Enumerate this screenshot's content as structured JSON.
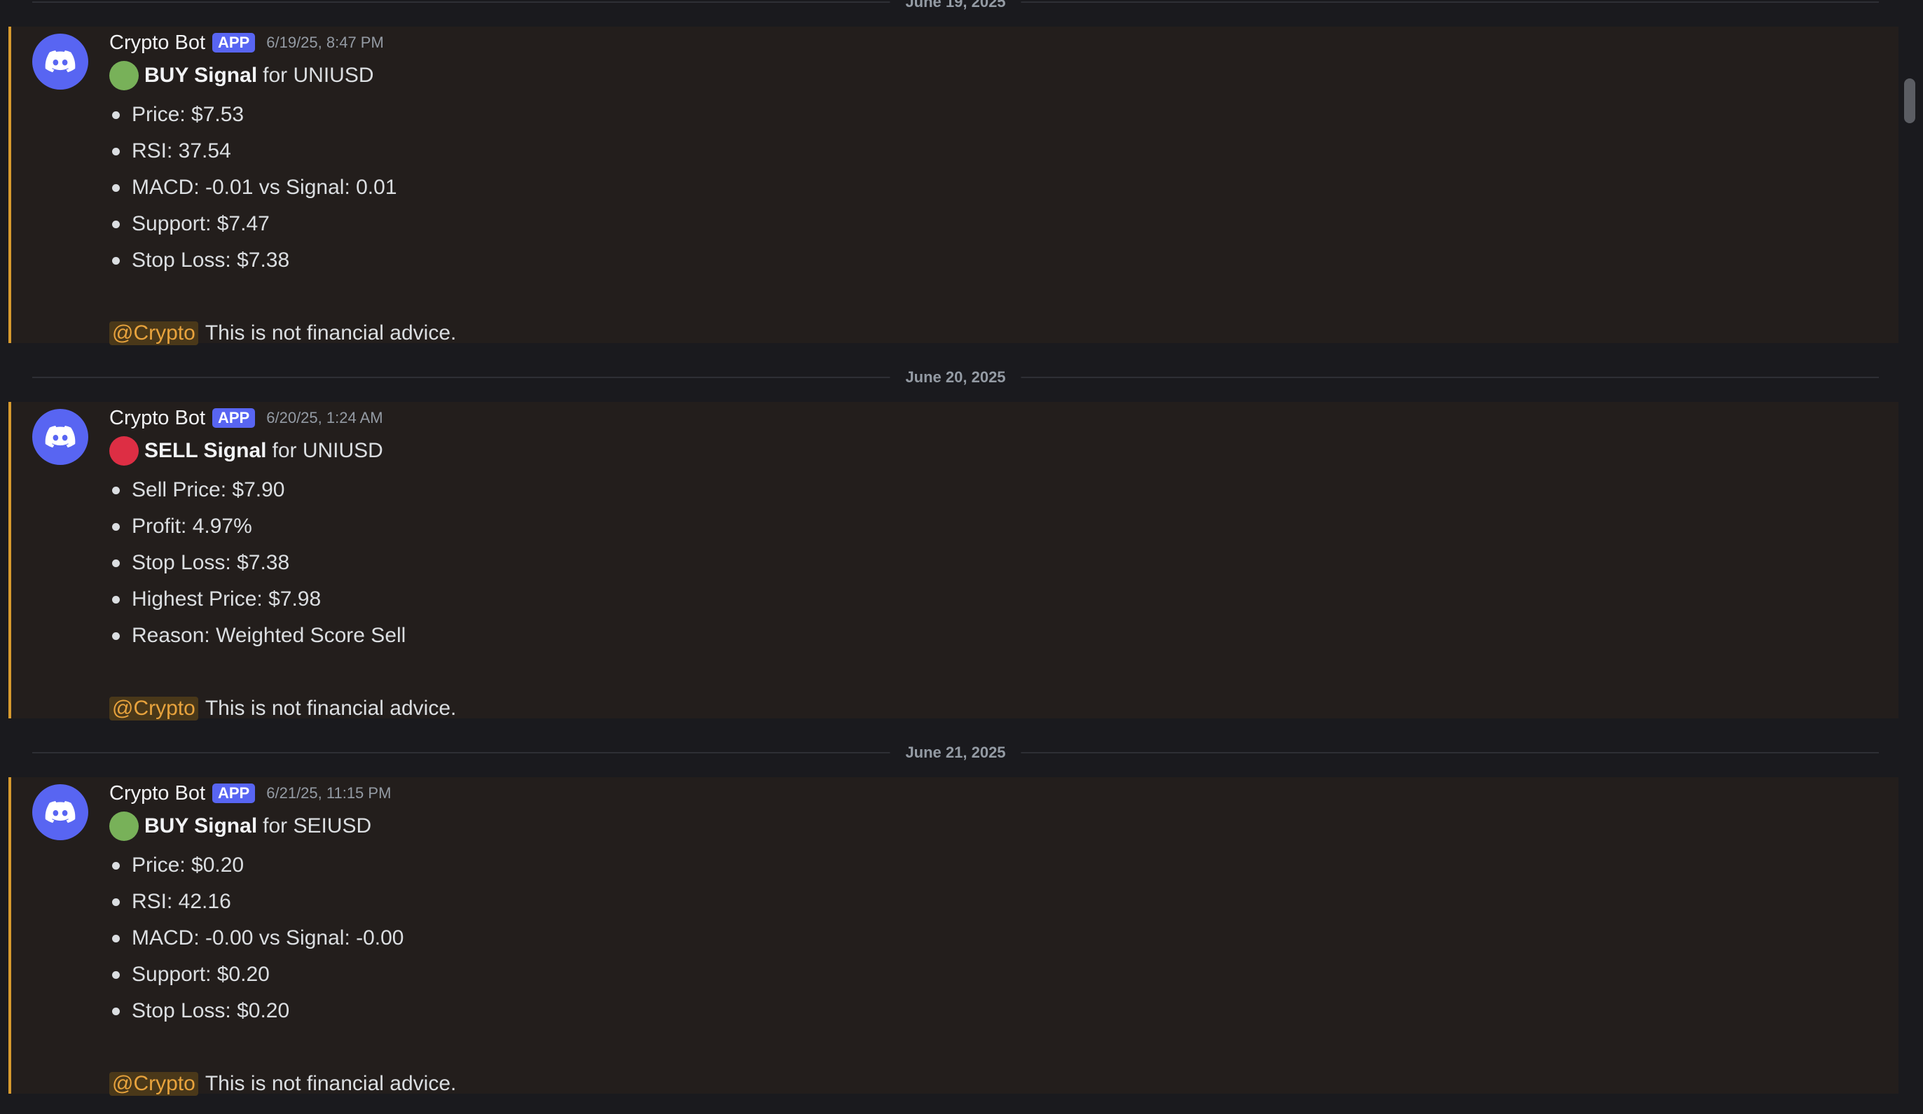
{
  "dividers": [
    "June 19, 2025",
    "June 20, 2025",
    "June 21, 2025"
  ],
  "messages": [
    {
      "username": "Crypto Bot",
      "badge": "APP",
      "timestamp": "6/19/25, 8:47 PM",
      "signal_color": "#78b159",
      "signal_label": "BUY Signal",
      "signal_rest": "for UNIUSD",
      "bullets": [
        "Price: $7.53",
        "RSI: 37.54",
        "MACD: -0.01 vs Signal: 0.01",
        "Support: $7.47",
        "Stop Loss: $7.38"
      ],
      "mention": "@Crypto",
      "disclaimer": "This is not financial advice."
    },
    {
      "username": "Crypto Bot",
      "badge": "APP",
      "timestamp": "6/20/25, 1:24 AM",
      "signal_color": "#dd2e44",
      "signal_label": "SELL Signal",
      "signal_rest": "for UNIUSD",
      "bullets": [
        "Sell Price: $7.90",
        "Profit: 4.97%",
        "Stop Loss: $7.38",
        "Highest Price: $7.98",
        "Reason: Weighted Score Sell"
      ],
      "mention": "@Crypto",
      "disclaimer": "This is not financial advice."
    },
    {
      "username": "Crypto Bot",
      "badge": "APP",
      "timestamp": "6/21/25, 11:15 PM",
      "signal_color": "#78b159",
      "signal_label": "BUY Signal",
      "signal_rest": "for SEIUSD",
      "bullets": [
        "Price: $0.20",
        "RSI: 42.16",
        "MACD: -0.00 vs Signal: -0.00",
        "Support: $0.20",
        "Stop Loss: $0.20"
      ],
      "mention": "@Crypto",
      "disclaimer": "This is not financial advice."
    }
  ],
  "colors": {
    "background": "#1a1a1e",
    "highlighted_message": "#231e1c",
    "highlight_bar": "#d79a2e",
    "avatar": "#5865f2",
    "app_badge": "#5865f2",
    "mention_text": "#e8a33d",
    "mention_bg": "#4a3819"
  },
  "icons": {
    "avatar_icon": "discord-logo-icon",
    "buy_icon": "green-circle-icon",
    "sell_icon": "red-circle-icon"
  }
}
